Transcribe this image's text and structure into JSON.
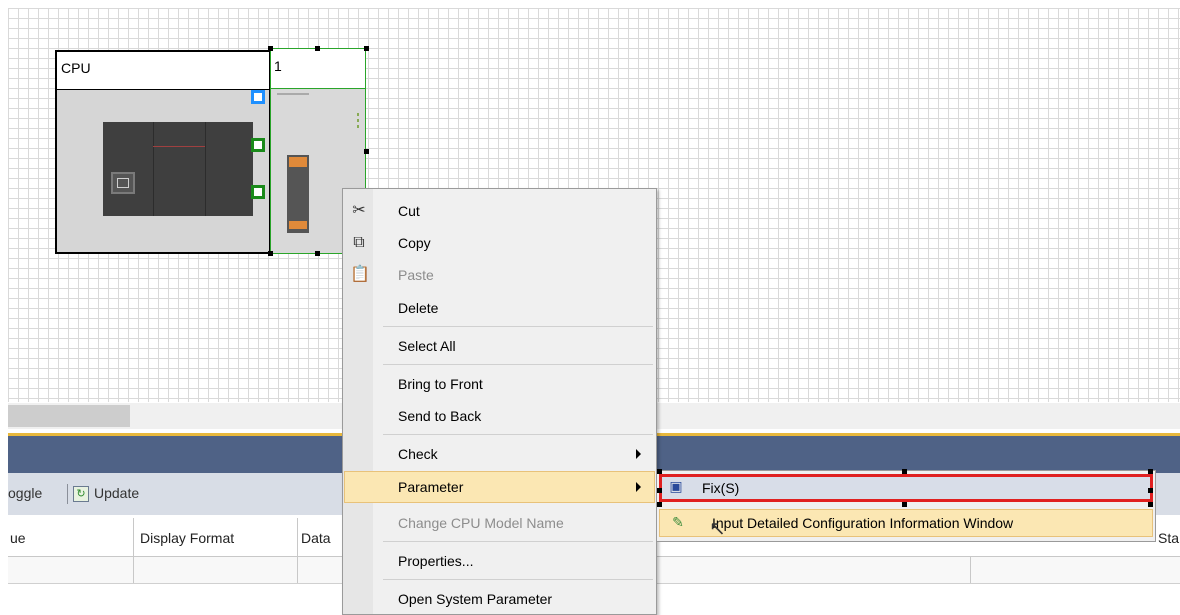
{
  "canvas": {
    "cpu_module": {
      "label": "CPU"
    },
    "io_module": {
      "label": "1"
    }
  },
  "panel": {
    "toolbar": {
      "toggle_partial": "oggle",
      "update_label": "Update"
    },
    "table": {
      "columns": [
        "ue",
        "Display Format",
        "Data",
        "Sta"
      ]
    }
  },
  "context_menu": {
    "cut": "Cut",
    "copy": "Copy",
    "paste": "Paste",
    "delete": "Delete",
    "select_all": "Select All",
    "bring_to_front": "Bring to Front",
    "send_to_back": "Send to Back",
    "check": "Check",
    "parameter": "Parameter",
    "change_cpu_model_name": "Change CPU Model Name",
    "properties": "Properties...",
    "open_system_parameter": "Open System Parameter"
  },
  "parameter_submenu": {
    "fix": "Fix(S)",
    "input_detail": "Input Detailed Configuration Information Window"
  },
  "colors": {
    "menu_highlight": "#fbe7b3",
    "selection_red": "#e02020",
    "panel_header": "#4f6286"
  }
}
